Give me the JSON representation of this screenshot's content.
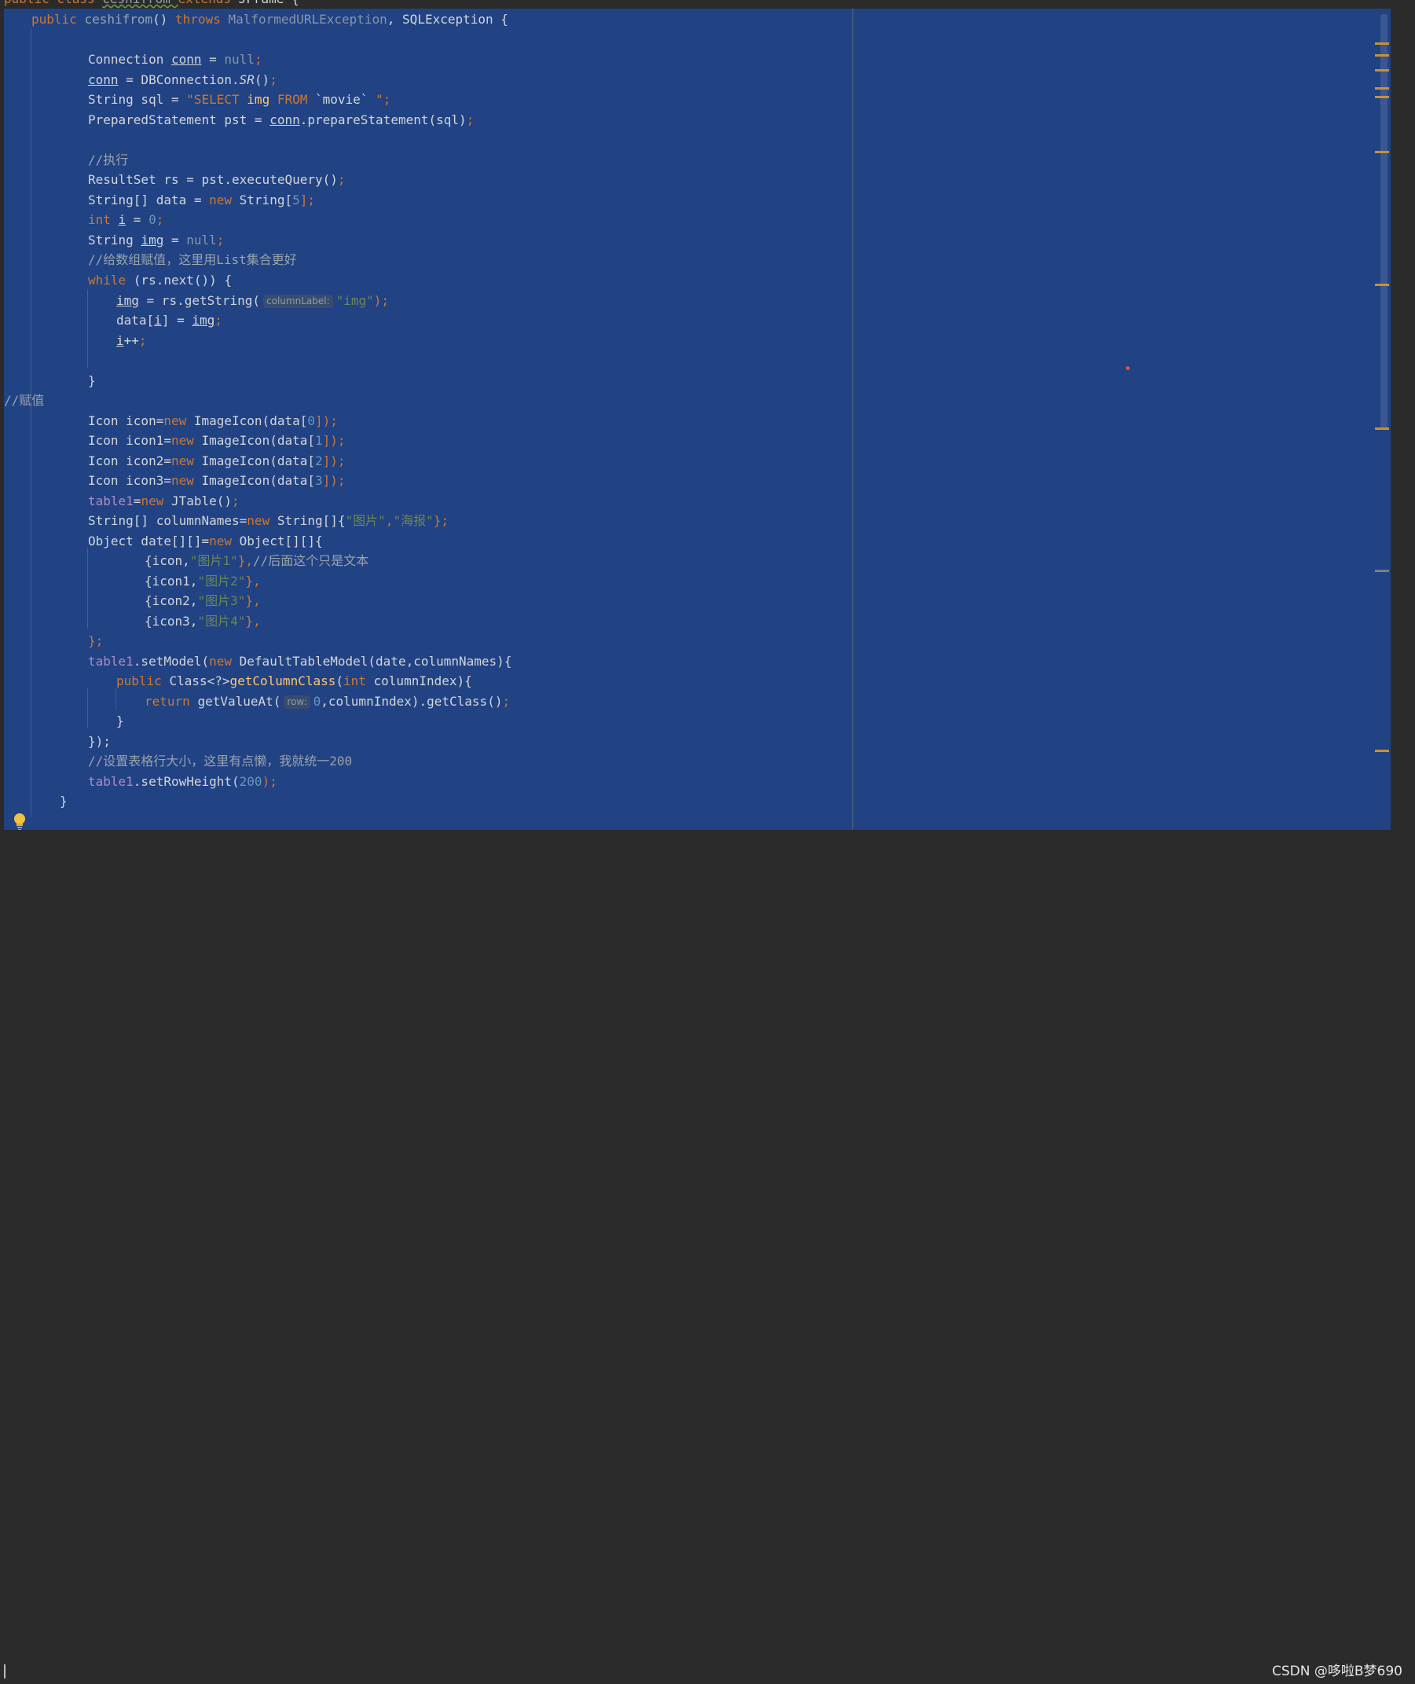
{
  "editor": {
    "line0": {
      "a": "public ",
      "b": "class ",
      "c": "ceshifrom ",
      "d": "extends ",
      "e": "JFrame {"
    },
    "line1": {
      "a": "public ",
      "b": "ceshifrom",
      "c": "() ",
      "d": "throws ",
      "e": "MalformedURLException",
      "f": ", SQLException {"
    },
    "line2": {
      "a": "Connection ",
      "b": "conn",
      "c": " = ",
      "d": "null",
      ";": ";"
    },
    "line3": {
      "a": "conn",
      "b": " = DBConnection.",
      "c": "SR",
      "d": "()",
      "e": ";"
    },
    "line4": {
      "a": "String sql = ",
      "b": "\"SELECT ",
      "c": "img ",
      "d": "FROM ",
      "e": "`movie` ",
      "f": "\";"
    },
    "line5": {
      "a": "PreparedStatement pst = ",
      "b": "conn",
      "c": ".prepareStatement(sql)",
      "d": ";"
    },
    "line6": {
      "a": "//执行"
    },
    "line7": {
      "a": "ResultSet rs = pst.executeQuery()",
      "b": ";"
    },
    "line8": {
      "a": "String[] data = ",
      "b": "new ",
      "c": "String[",
      "d": "5",
      "e": "];"
    },
    "line9": {
      "a": "int ",
      "b": "i",
      "c": " = ",
      "d": "0",
      "e": ";"
    },
    "line10": {
      "a": "String ",
      "b": "img",
      "c": " = ",
      "d": "null",
      "e": ";"
    },
    "line11": {
      "a": "//给数组赋值，这里用List集合更好"
    },
    "line12": {
      "a": "while ",
      "b": "(rs.next()) {"
    },
    "line13": {
      "a": "img",
      "b": " = rs.getString(",
      "hint": "columnLabel:",
      "c": "\"img\"",
      "d": ");"
    },
    "line14": {
      "a": "data[",
      "b": "i",
      "c": "] = ",
      "d": "img",
      "e": ";"
    },
    "line15": {
      "a": "i",
      "b": "++",
      "c": ";"
    },
    "line16": {
      "a": "}"
    },
    "line17": {
      "a": "//赋值"
    },
    "line18": {
      "a": "Icon icon=",
      "b": "new ",
      "c": "ImageIcon(data[",
      "d": "0",
      "e": "]);"
    },
    "line19": {
      "a": "Icon icon1=",
      "b": "new ",
      "c": "ImageIcon(data[",
      "d": "1",
      "e": "]);"
    },
    "line20": {
      "a": "Icon icon2=",
      "b": "new ",
      "c": "ImageIcon(data[",
      "d": "2",
      "e": "]);"
    },
    "line21": {
      "a": "Icon icon3=",
      "b": "new ",
      "c": "ImageIcon(data[",
      "d": "3",
      "e": "]);"
    },
    "line22": {
      "a": "table1",
      "b": "=",
      "c": "new ",
      "d": "JTable()",
      "e": ";"
    },
    "line23": {
      "a": "String[] columnNames=",
      "b": "new ",
      "c": "String[]{",
      "d": "\"图片\"",
      "e": ",",
      "f": "\"海报\"",
      "g": "};"
    },
    "line24": {
      "a": "Object date[][]=",
      "b": "new ",
      "c": "Object[][]{"
    },
    "line25": {
      "a": "{icon,",
      "b": "\"图片1\"",
      "c": "},",
      "d": "//后面这个只是文本"
    },
    "line26": {
      "a": "{icon1,",
      "b": "\"图片2\"",
      "c": "},"
    },
    "line27": {
      "a": "{icon2,",
      "b": "\"图片3\"",
      "c": "},"
    },
    "line28": {
      "a": "{icon3,",
      "b": "\"图片4\"",
      "c": "},"
    },
    "line29": {
      "a": "};"
    },
    "line30": {
      "a": "table1",
      "b": ".setModel(",
      "c": "new ",
      "d": "DefaultTableModel(date,columnNames){"
    },
    "line31": {
      "a": "public ",
      "b": "Class<?>",
      "c": "getColumnClass",
      "d": "(",
      "e": "int ",
      "f": "columnIndex){"
    },
    "line32": {
      "a": "return ",
      "b": "getValueAt(",
      "hint": "row:",
      "c": "0",
      "d": ",columnIndex).getClass()",
      "e": ";"
    },
    "line33": {
      "a": "}"
    },
    "line34": {
      "a": "});"
    },
    "line35": {
      "a": "//设置表格行大小，这里有点懒，我就统一200"
    },
    "line36": {
      "a": "table1",
      "b": ".setRowHeight(",
      "c": "200",
      "d": ");"
    },
    "line37": {
      "a": "}"
    }
  },
  "watermark": "CSDN @哆啦B梦690",
  "icons": {
    "bulb": "lightbulb-icon"
  },
  "colors": {
    "selection": "#214283",
    "keyword": "#cc7832",
    "string": "#6a8759",
    "number": "#6897bb",
    "method": "#ffc66d",
    "field": "#b08cc2",
    "comment": "#9aa3ad",
    "marker": "#c9922e"
  }
}
